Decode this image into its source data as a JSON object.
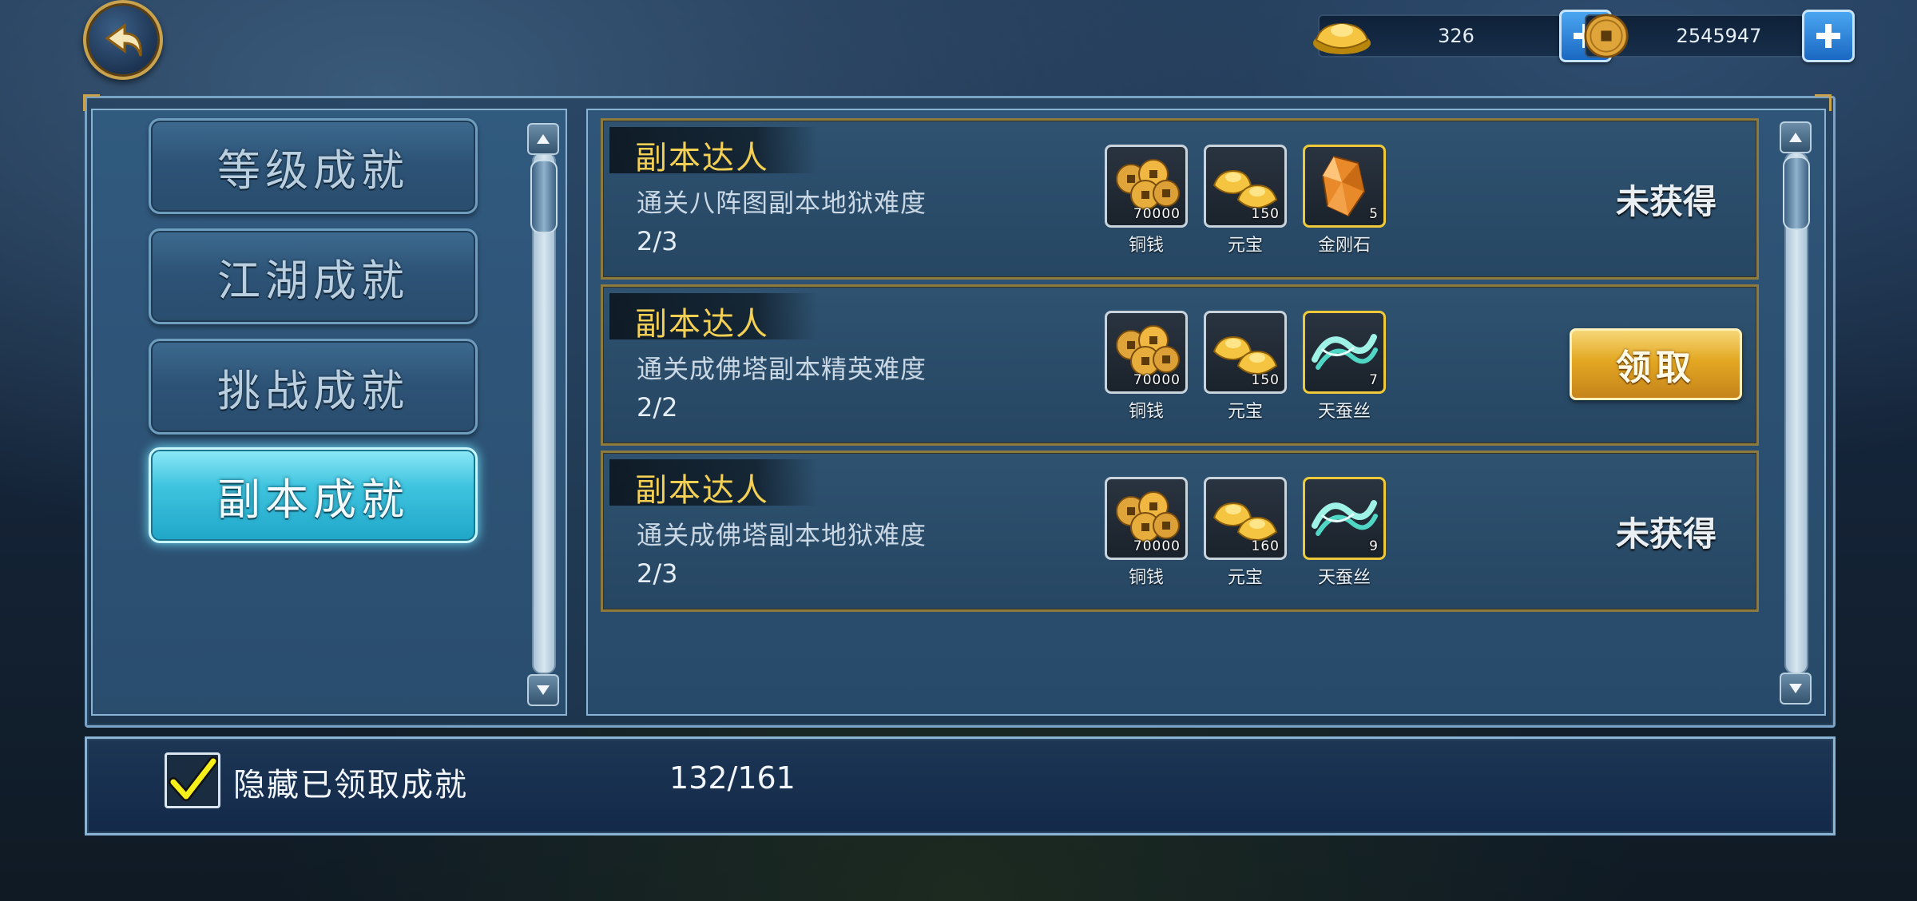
{
  "currency": {
    "ingot": {
      "icon": "gold-ingot-icon",
      "value": "326"
    },
    "coin": {
      "icon": "copper-coin-icon",
      "value": "2545947"
    }
  },
  "tabs": [
    {
      "label": "等级成就",
      "active": false
    },
    {
      "label": "江湖成就",
      "active": false
    },
    {
      "label": "挑战成就",
      "active": false
    },
    {
      "label": "副本成就",
      "active": true
    }
  ],
  "achievements": [
    {
      "title": "副本达人",
      "desc": "通关八阵图副本地狱难度",
      "progress": "2/3",
      "rewards": [
        {
          "icon": "copper-coins-icon",
          "qty": "70000",
          "name": "铜钱"
        },
        {
          "icon": "gold-ingot-icon",
          "qty": "150",
          "name": "元宝"
        },
        {
          "icon": "diamond-stone-icon",
          "qty": "5",
          "name": "金刚石"
        }
      ],
      "status": "未获得"
    },
    {
      "title": "副本达人",
      "desc": "通关成佛塔副本精英难度",
      "progress": "2/2",
      "rewards": [
        {
          "icon": "copper-coins-icon",
          "qty": "70000",
          "name": "铜钱"
        },
        {
          "icon": "gold-ingot-icon",
          "qty": "150",
          "name": "元宝"
        },
        {
          "icon": "silk-thread-icon",
          "qty": "7",
          "name": "天蚕丝"
        }
      ],
      "claim_label": "领取"
    },
    {
      "title": "副本达人",
      "desc": "通关成佛塔副本地狱难度",
      "progress": "2/3",
      "rewards": [
        {
          "icon": "copper-coins-icon",
          "qty": "70000",
          "name": "铜钱"
        },
        {
          "icon": "gold-ingot-icon",
          "qty": "160",
          "name": "元宝"
        },
        {
          "icon": "silk-thread-icon",
          "qty": "9",
          "name": "天蚕丝"
        }
      ],
      "status": "未获得"
    }
  ],
  "footer": {
    "hide_claimed_label": "隐藏已领取成就",
    "hide_claimed_checked": true,
    "count": "132/161"
  },
  "colors": {
    "title_gold": "#f3cf53",
    "active_tab": "#3fc4df",
    "claim_button": "#e3a722"
  }
}
